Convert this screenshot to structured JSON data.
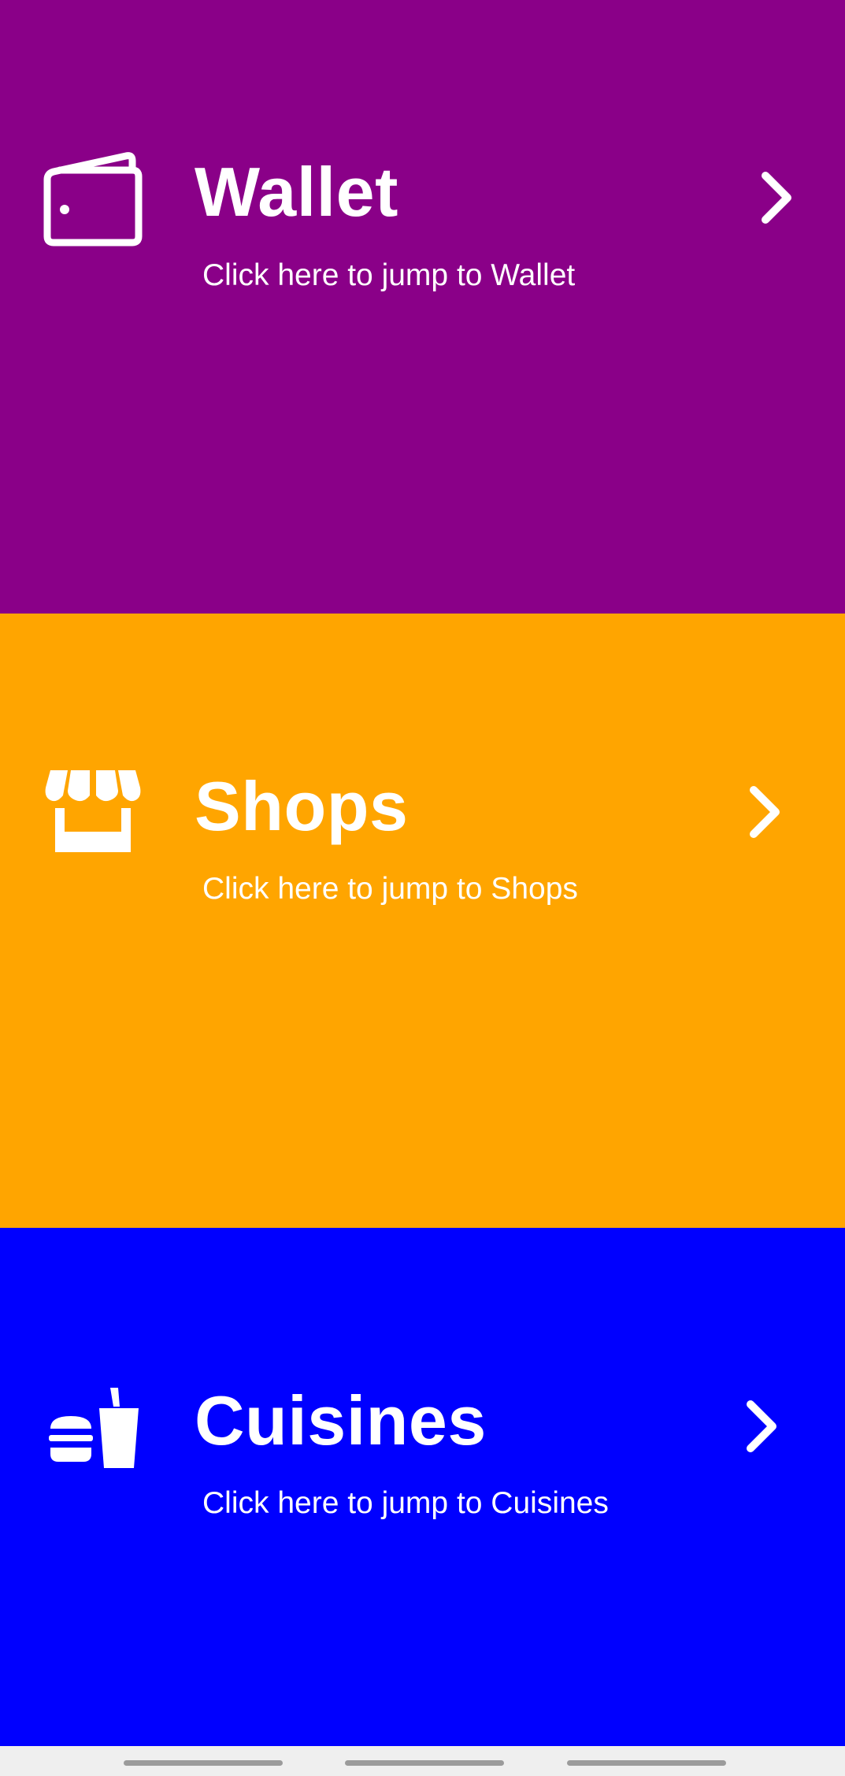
{
  "colors": {
    "wallet_bg": "#8a0088",
    "shops_bg": "#ffa500",
    "cuisines_bg": "#0000ff",
    "text": "#ffffff",
    "nav_bar_bg": "#efefef",
    "nav_handle": "#9b9b9b"
  },
  "panels": [
    {
      "id": "wallet",
      "icon": "wallet-icon",
      "title": "Wallet",
      "subtitle": "Click here to jump to Wallet",
      "chevron": "chevron-right-icon"
    },
    {
      "id": "shops",
      "icon": "storefront-icon",
      "title": "Shops",
      "subtitle": "Click here to jump to Shops",
      "chevron": "chevron-right-icon"
    },
    {
      "id": "cuisines",
      "icon": "fastfood-icon",
      "title": "Cuisines",
      "subtitle": "Click here to jump to Cuisines",
      "chevron": "chevron-right-icon"
    }
  ],
  "nav_bar": {
    "handles": [
      "left-handle",
      "center-handle",
      "right-handle"
    ]
  }
}
